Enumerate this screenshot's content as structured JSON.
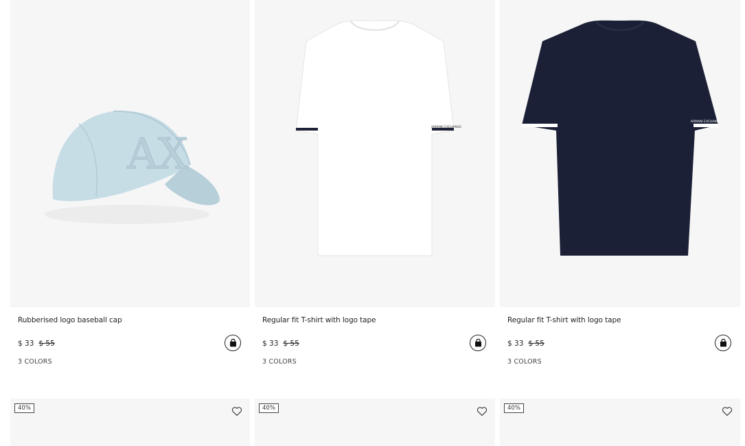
{
  "products": [
    {
      "name": "Rubberised logo baseball cap",
      "price": "$ 33",
      "old_price": "$ 55",
      "colors": "3 COLORS",
      "image_icon": "baseball-cap-image"
    },
    {
      "name": "Regular fit T-shirt with logo tape",
      "price": "$ 33",
      "old_price": "$ 55",
      "colors": "3 COLORS",
      "image_icon": "white-tshirt-image",
      "tape_text": "ARMANI EXCHANGE"
    },
    {
      "name": "Regular fit T-shirt with logo tape",
      "price": "$ 33",
      "old_price": "$ 55",
      "colors": "3 COLORS",
      "image_icon": "navy-tshirt-image",
      "tape_text": "ARMANI EXCHANGE"
    }
  ],
  "next_row": [
    {
      "badge": "40%"
    },
    {
      "badge": "40%"
    },
    {
      "badge": "40%"
    }
  ],
  "icons": {
    "bag": "shopping-bag-icon",
    "wishlist": "heart-icon"
  },
  "colors": {
    "cap": "#c7dde6",
    "white_tee": "#ffffff",
    "navy_tee": "#1b2036",
    "tile_bg": "#f6f6f6"
  }
}
